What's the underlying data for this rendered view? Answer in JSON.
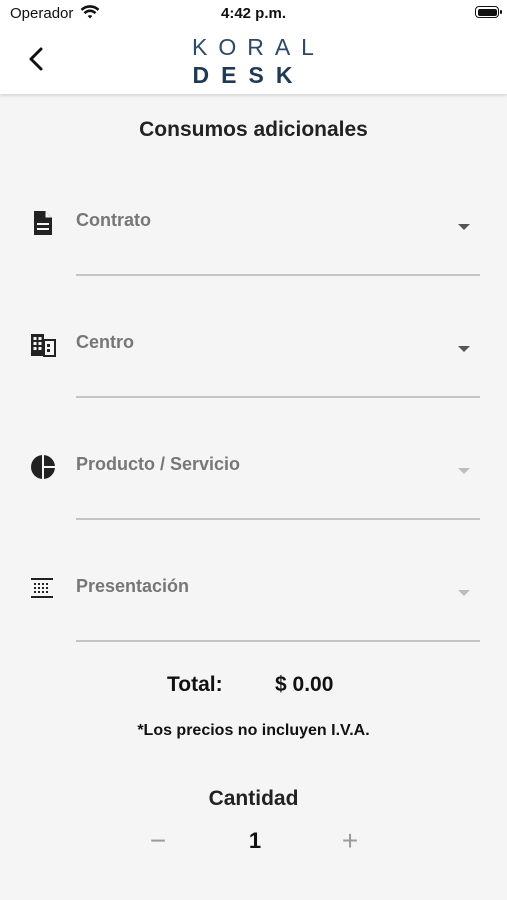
{
  "status_bar": {
    "carrier": "Operador",
    "time": "4:42 p.m."
  },
  "header": {
    "logo_line1": "KORAL",
    "logo_line2": "DESK",
    "back_icon": "chevron-left-icon"
  },
  "page": {
    "title": "Consumos adicionales"
  },
  "fields": [
    {
      "label": "Contrato",
      "icon": "document-icon",
      "enabled": true
    },
    {
      "label": "Centro",
      "icon": "building-icon",
      "enabled": true
    },
    {
      "label": "Producto / Servicio",
      "icon": "pie-chart-icon",
      "enabled": false
    },
    {
      "label": "Presentación",
      "icon": "grid-list-icon",
      "enabled": false
    }
  ],
  "summary": {
    "total_label": "Total:",
    "total_value": "$ 0.00",
    "note": "*Los precios no incluyen I.V.A."
  },
  "quantity": {
    "label": "Cantidad",
    "value": "1",
    "minus": "−",
    "plus": "+"
  },
  "colors": {
    "brand": "#2c4a67",
    "background": "#f5f5f5",
    "label_gray": "#777777"
  }
}
